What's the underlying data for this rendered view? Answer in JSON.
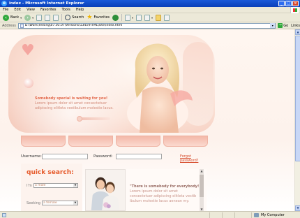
{
  "window": {
    "title": "index - Microsoft Internet Explorer",
    "controls": [
      "_",
      "□",
      "×"
    ]
  },
  "menu": [
    "File",
    "Edit",
    "View",
    "Favorites",
    "Tools",
    "Help"
  ],
  "toolbar": {
    "back": "Back",
    "search": "Search",
    "favorites": "Favorites"
  },
  "address": {
    "label": "Address",
    "url": "D:\\Work\\Testing\\07.03.07\\Versions\\1345\\HTML\\site\\index.html",
    "go": "Go",
    "links": "Links"
  },
  "hero": {
    "headline": "Somebody special is waiting for you!",
    "body": "Lorem ipsum dolor sit amet consectetuer adipiscing elitleta vestibulum molestie lacus."
  },
  "login": {
    "username_label": "Username:",
    "password_label": "Password:",
    "forgot": "Forgot password?"
  },
  "quick_search": {
    "title": "quick search:",
    "i_am_label": "I'm",
    "i_am_value": "a male",
    "seeking_label": "Seeking",
    "seeking_value": "a female"
  },
  "card": {
    "headline": "\"There is somebody for everybody!",
    "body": "Lorem ipsum dolor sit amet consectetuer adipiscing elitleta vestib ibulum molestie lacus aenean my."
  },
  "status": {
    "zone": "My Computer"
  },
  "colors": {
    "accent": "#e65b2c",
    "hero_pink": "#f3c4b4",
    "title_blue": "#0a3fb8"
  }
}
